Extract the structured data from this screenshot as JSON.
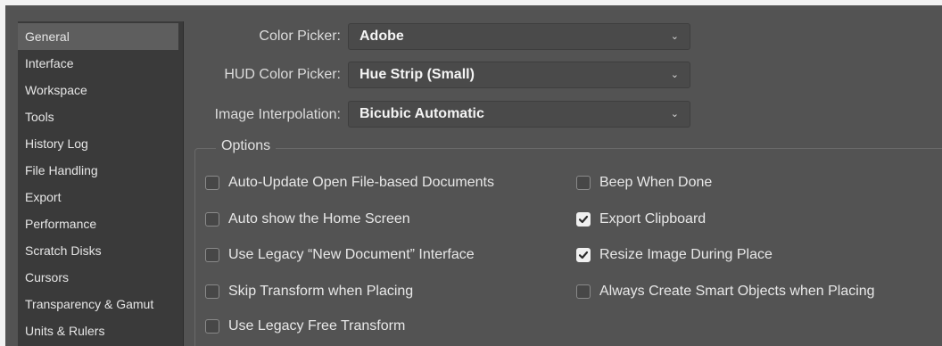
{
  "sidebar": {
    "items": [
      {
        "label": "General",
        "selected": true
      },
      {
        "label": "Interface"
      },
      {
        "label": "Workspace"
      },
      {
        "label": "Tools"
      },
      {
        "label": "History Log"
      },
      {
        "label": "File Handling"
      },
      {
        "label": "Export"
      },
      {
        "label": "Performance"
      },
      {
        "label": "Scratch Disks"
      },
      {
        "label": "Cursors"
      },
      {
        "label": "Transparency & Gamut"
      },
      {
        "label": "Units & Rulers"
      }
    ]
  },
  "fields": {
    "color_picker": {
      "label": "Color Picker:",
      "value": "Adobe"
    },
    "hud_color_picker": {
      "label": "HUD Color Picker:",
      "value": "Hue Strip (Small)"
    },
    "image_interpolation": {
      "label": "Image Interpolation:",
      "value": "Bicubic Automatic"
    }
  },
  "options": {
    "title": "Options",
    "left": [
      {
        "label": "Auto-Update Open File-based Documents",
        "checked": false
      },
      {
        "label": "Auto show the Home Screen",
        "checked": false
      },
      {
        "label": "Use Legacy “New Document” Interface",
        "checked": false
      },
      {
        "label": "Skip Transform when Placing",
        "checked": false
      },
      {
        "label": "Use Legacy Free Transform",
        "checked": false
      }
    ],
    "right": [
      {
        "label": "Beep When Done",
        "checked": false
      },
      {
        "label": "Export Clipboard",
        "checked": true
      },
      {
        "label": "Resize Image During Place",
        "checked": true
      },
      {
        "label": "Always Create Smart Objects when Placing",
        "checked": false
      }
    ]
  },
  "icons": {
    "dropdown": "chevron-down-icon",
    "check": "checkmark-icon"
  },
  "colors": {
    "panel_bg": "#535353",
    "sidebar_bg": "#3a3a3a",
    "selected_bg": "#5e5e5e",
    "outer_bg": "#f2f2f2"
  }
}
